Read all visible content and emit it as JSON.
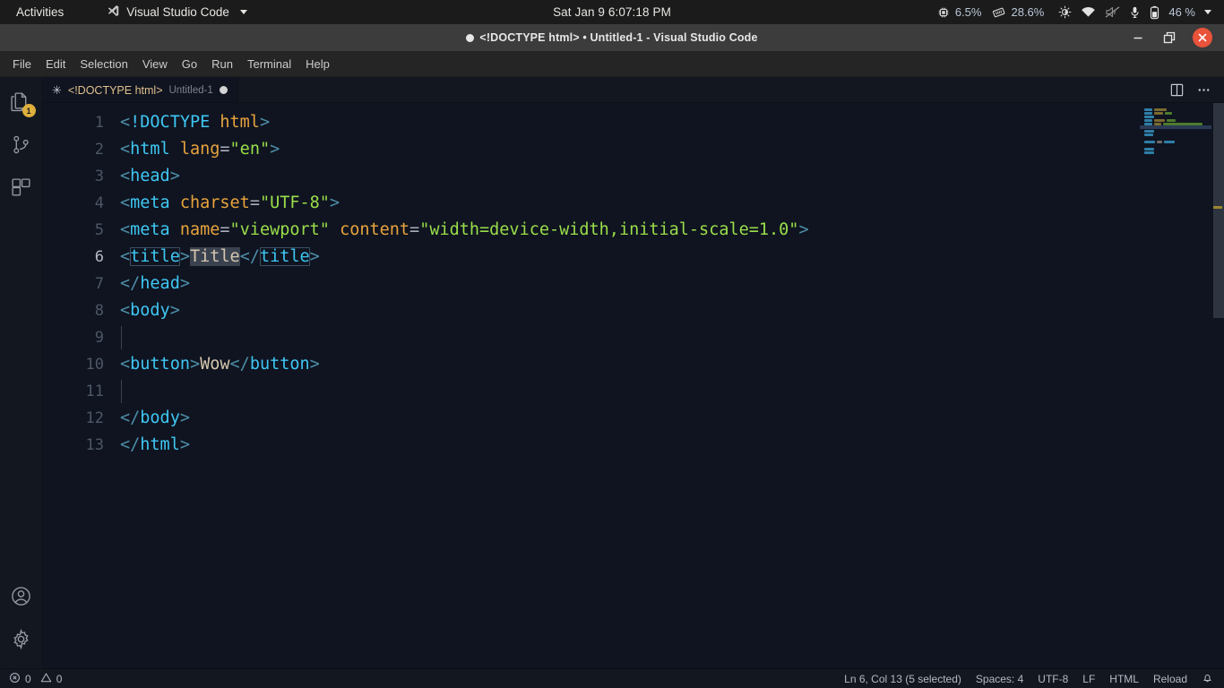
{
  "gnome": {
    "activities": "Activities",
    "app_menu": "Visual Studio Code",
    "app_icon": "vscode-icon",
    "clock": "Sat Jan 9  6:07:18 PM",
    "cpu_label": "6.5%",
    "ram_label": "28.6%",
    "battery_label": "46 %",
    "tray_icons": [
      "cpu-icon",
      "ram-icon",
      "brightness-icon",
      "wifi-icon",
      "volume-muted-icon",
      "microphone-icon",
      "battery-icon"
    ]
  },
  "window": {
    "title": "<!DOCTYPE html> • Untitled-1 - Visual Studio Code",
    "dirty_indicator": "●",
    "minimize": "minimize-button",
    "maximize": "maximize-button",
    "close": "close-button",
    "close_color": "#e9533a"
  },
  "menubar": {
    "items": [
      "File",
      "Edit",
      "Selection",
      "View",
      "Go",
      "Run",
      "Terminal",
      "Help"
    ]
  },
  "activitybar": {
    "items": [
      {
        "name": "explorer",
        "icon": "files-icon",
        "badge": "1"
      },
      {
        "name": "source-control",
        "icon": "source-control-icon",
        "badge": ""
      },
      {
        "name": "extensions",
        "icon": "extensions-icon",
        "badge": ""
      }
    ],
    "bottom": [
      {
        "name": "accounts",
        "icon": "account-icon"
      },
      {
        "name": "manage",
        "icon": "gear-icon"
      }
    ]
  },
  "tab": {
    "icon": "html-file-icon",
    "label": "<!DOCTYPE html>",
    "description": "Untitled-1",
    "dirty": true
  },
  "editor_actions": {
    "split": "split-editor-icon",
    "more": "more-actions-icon"
  },
  "editor": {
    "language": "html",
    "lines": [
      {
        "n": 1,
        "text": "<!DOCTYPE html>"
      },
      {
        "n": 2,
        "text": "<html lang=\"en\">"
      },
      {
        "n": 3,
        "text": "<head>"
      },
      {
        "n": 4,
        "text": "<meta charset=\"UTF-8\">"
      },
      {
        "n": 5,
        "text": "<meta name=\"viewport\" content=\"width=device-width,initial-scale=1.0\">"
      },
      {
        "n": 6,
        "text": "<title>Title</title>"
      },
      {
        "n": 7,
        "text": "</head>"
      },
      {
        "n": 8,
        "text": "<body>"
      },
      {
        "n": 9,
        "text": ""
      },
      {
        "n": 10,
        "text": "<button>Wow</button>"
      },
      {
        "n": 11,
        "text": ""
      },
      {
        "n": 12,
        "text": "</body>"
      },
      {
        "n": 13,
        "text": "</html>"
      }
    ],
    "active_line": 6,
    "selection_text": "Title",
    "colors": {
      "background": "#0f1420",
      "tag": "#3fc7f4",
      "bracket": "#4d8ea8",
      "attribute": "#e8a33d",
      "string": "#9ade4a",
      "text": "#d6c6ae",
      "line_number": "#4e5766",
      "selection": "#3a4250"
    }
  },
  "statusbar": {
    "errors": "0",
    "warnings": "0",
    "position": "Ln 6, Col 13 (5 selected)",
    "indentation": "Spaces: 4",
    "encoding": "UTF-8",
    "eol": "LF",
    "language": "HTML",
    "reload": "Reload",
    "notifications": "bell-icon"
  }
}
